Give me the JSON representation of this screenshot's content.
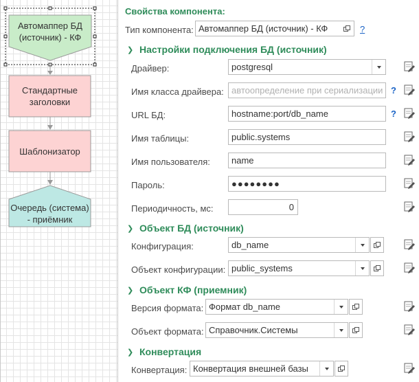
{
  "diagram": {
    "nodes": [
      {
        "label_line1": "Автомаппер БД",
        "label_line2": "(источник) - КФ",
        "fill": "#c9ecc9",
        "selected": true
      },
      {
        "label_line1": "Стандартные",
        "label_line2": "заголовки",
        "fill": "#fdd3d3"
      },
      {
        "label_line1": "Шаблонизатор",
        "label_line2": "",
        "fill": "#fdd3d3"
      },
      {
        "label_line1": "Очередь (система)",
        "label_line2": "- приёмник",
        "fill": "#bde8e4"
      }
    ]
  },
  "props": {
    "header": "Свойства компонента:",
    "component_type_label": "Тип компонента:",
    "component_type_value": "Автомаппер БД (источник) - КФ",
    "help_q": "?",
    "sections": {
      "db_connection": {
        "title": "Настройки подключения БД (источник)",
        "driver_label": "Драйвер:",
        "driver_value": "postgresql",
        "driver_class_label": "Имя класса драйвера:",
        "driver_class_placeholder": "автоопределение при сериализации",
        "url_label": "URL БД:",
        "url_value": "hostname:port/db_name",
        "table_label": "Имя таблицы:",
        "table_value": "public.systems",
        "user_label": "Имя пользователя:",
        "user_value": "name",
        "password_label": "Пароль:",
        "password_value": "●●●●●●●●",
        "period_label": "Периодичность, мс:",
        "period_value": "0"
      },
      "db_object": {
        "title": "Объект БД (источник)",
        "config_label": "Конфигурация:",
        "config_value": "db_name",
        "config_object_label": "Объект конфигурации:",
        "config_object_value": "public_systems"
      },
      "kf_object": {
        "title": "Объект КФ (приемник)",
        "format_version_label": "Версия формата:",
        "format_version_value": "Формат db_name",
        "format_object_label": "Объект формата:",
        "format_object_value": "Справочник.Системы"
      },
      "conversion": {
        "title": "Конвертация",
        "conversion_label": "Конвертация:",
        "conversion_value": "Конвертация внешней базы"
      }
    }
  },
  "colors": {
    "accent_green": "#2f8c5a",
    "help_blue": "#1a63c6",
    "field_border": "#b9b9b9"
  }
}
